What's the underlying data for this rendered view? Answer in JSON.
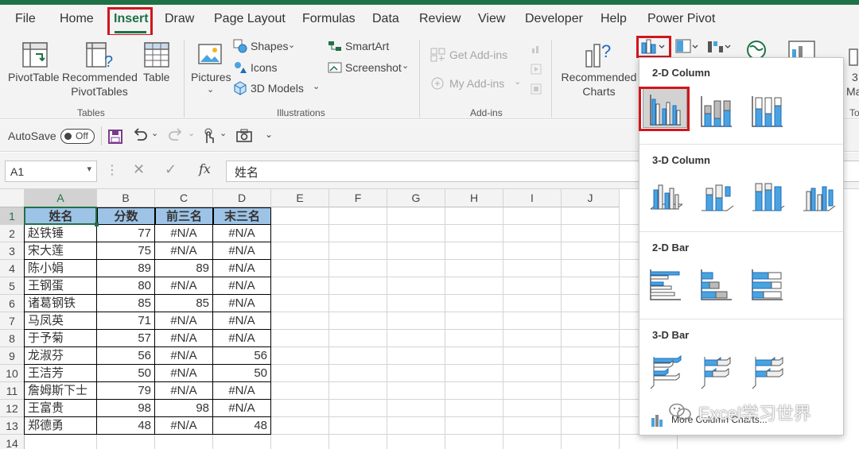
{
  "tabs": [
    "File",
    "Home",
    "Insert",
    "Draw",
    "Page Layout",
    "Formulas",
    "Data",
    "Review",
    "View",
    "Developer",
    "Help",
    "Power Pivot"
  ],
  "ribbon": {
    "pivottable": "PivotTable",
    "recommended_pivot_1": "Recommended",
    "recommended_pivot_2": "PivotTables",
    "table": "Table",
    "group_tables": "Tables",
    "pictures": "Pictures",
    "shapes": "Shapes",
    "icons": "Icons",
    "models_3d": "3D Models",
    "smartart": "SmartArt",
    "screenshot": "Screenshot",
    "group_illustrations": "Illustrations",
    "get_addins": "Get Add-ins",
    "my_addins": "My Add-ins",
    "group_addins": "Add-ins",
    "recommended_charts_1": "Recommended",
    "recommended_charts_2": "Charts",
    "partial_3": "3",
    "partial_ma": "Ma",
    "partial_to": "To"
  },
  "qat": {
    "autosave_label": "AutoSave",
    "toggle_state": "Off"
  },
  "formula_bar": {
    "name_box": "A1",
    "fx": "fx",
    "content": "姓名"
  },
  "sheet": {
    "columns": [
      "A",
      "B",
      "C",
      "D",
      "E",
      "F",
      "G",
      "H",
      "I",
      "J"
    ],
    "row_numbers": [
      "1",
      "2",
      "3",
      "4",
      "5",
      "6",
      "7",
      "8",
      "9",
      "10",
      "11",
      "12",
      "13",
      "14"
    ],
    "header": [
      "姓名",
      "分数",
      "前三名",
      "末三名"
    ],
    "rows": [
      [
        "赵铁锤",
        "77",
        "#N/A",
        "#N/A"
      ],
      [
        "宋大莲",
        "75",
        "#N/A",
        "#N/A"
      ],
      [
        "陈小娟",
        "89",
        "89",
        "#N/A"
      ],
      [
        "王钢蛋",
        "80",
        "#N/A",
        "#N/A"
      ],
      [
        "诸葛钢铁",
        "85",
        "85",
        "#N/A"
      ],
      [
        "马凤英",
        "71",
        "#N/A",
        "#N/A"
      ],
      [
        "于予菊",
        "57",
        "#N/A",
        "#N/A"
      ],
      [
        "龙淑芬",
        "56",
        "#N/A",
        "56"
      ],
      [
        "王洁芳",
        "50",
        "#N/A",
        "50"
      ],
      [
        "詹姆斯下士",
        "79",
        "#N/A",
        "#N/A"
      ],
      [
        "王富贵",
        "98",
        "98",
        "#N/A"
      ],
      [
        "郑德勇",
        "48",
        "#N/A",
        "48"
      ]
    ]
  },
  "chart_menu": {
    "sections": [
      "2-D Column",
      "3-D Column",
      "2-D Bar",
      "3-D Bar"
    ],
    "more": "More Column Charts..."
  },
  "watermark": "Excel学习世界",
  "colors": {
    "excel_green": "#1f7246",
    "header_fill": "#9dc3e6",
    "highlight_red": "#d0161c",
    "chart_blue": "#4aa3df"
  }
}
